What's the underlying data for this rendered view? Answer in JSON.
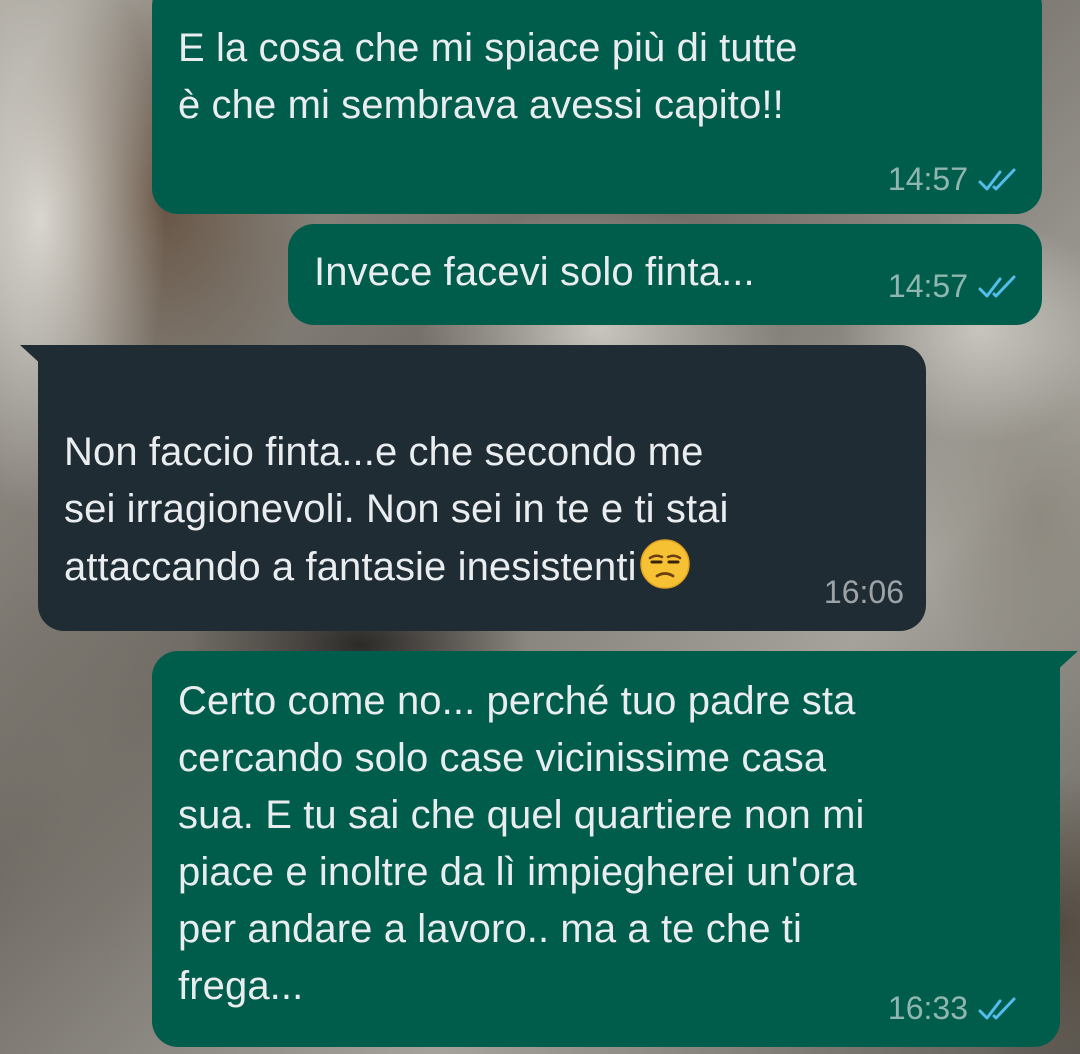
{
  "wallpaper": {
    "description_icon": "rock-wallpaper"
  },
  "colors": {
    "outgoing_bubble": "#005c4b",
    "incoming_bubble": "#202c33",
    "read_ticks": "#53bdeb"
  },
  "messages": [
    {
      "direction": "outgoing",
      "text": "E la cosa che mi spiace più di tutte\nè che mi sembrava avessi capito!!",
      "time": "14:57",
      "status_icon": "double-check-read-icon"
    },
    {
      "direction": "outgoing",
      "text": "Invece facevi solo finta...",
      "time": "14:57",
      "status_icon": "double-check-read-icon"
    },
    {
      "direction": "incoming",
      "text": "Non faccio finta...e che secondo me\nsei irragionevoli. Non sei in te e ti stai\nattaccando a fantasie inesistenti",
      "emoji_icon": "unamused-face-icon",
      "time": "16:06"
    },
    {
      "direction": "outgoing",
      "text": "Certo come no... perché tuo padre sta\ncercando solo case vicinissime casa\nsua. E tu sai che quel quartiere non mi\npiace e inoltre da lì impiegherei un'ora\nper andare a lavoro.. ma a te che ti\nfrega...",
      "time": "16:33",
      "status_icon": "double-check-read-icon"
    }
  ]
}
